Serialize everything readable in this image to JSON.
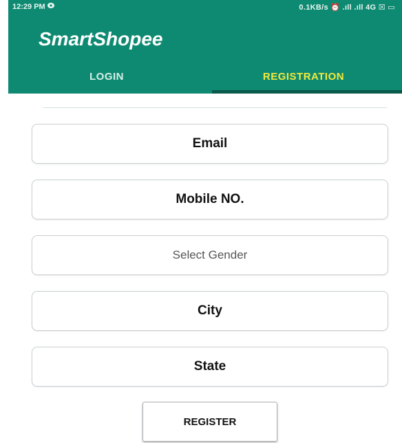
{
  "status_bar": {
    "time": "12:29 PM",
    "network": "0.1KB/s ⏰ .ıll .ıll 4G ☒ ▭"
  },
  "app": {
    "title": "SmartShopee",
    "primary_color": "#0f8a72",
    "active_tab_color": "#f2ea3c"
  },
  "tabs": [
    {
      "label": "LOGIN",
      "active": false
    },
    {
      "label": "REGISTRATION",
      "active": true
    }
  ],
  "form": {
    "email_placeholder": "Email",
    "mobile_placeholder": "Mobile NO.",
    "gender_select": "Select Gender",
    "city_placeholder": "City",
    "state_placeholder": "State",
    "register_label": "REGISTER"
  }
}
